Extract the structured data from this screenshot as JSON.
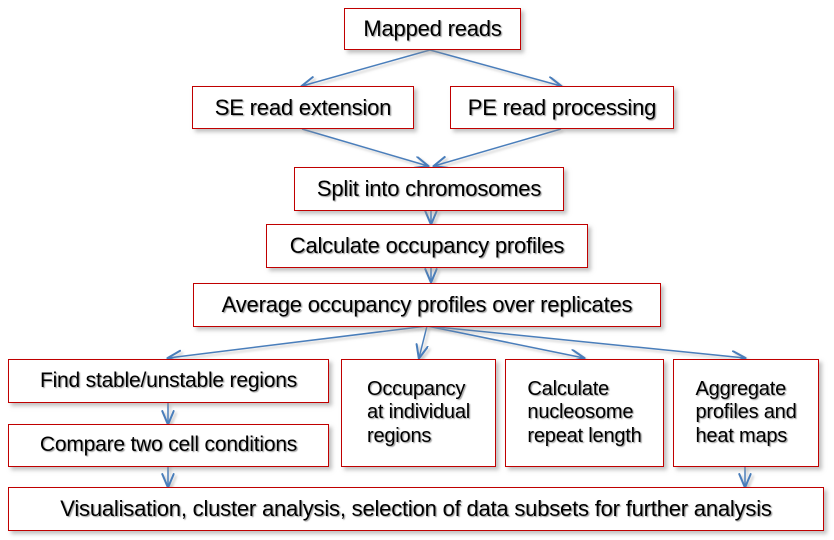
{
  "diagram": {
    "title": "Nucleosome occupancy analysis pipeline flowchart",
    "type": "flowchart",
    "colors": {
      "box_border": "#C00000",
      "box_fill": "#FFFFFF",
      "arrow": "#4A7EBB",
      "text": "#000000",
      "background": "#FFFFFF"
    },
    "nodes": {
      "mapped_reads": "Mapped reads",
      "se_read_extension": "SE read extension",
      "pe_read_processing": "PE read processing",
      "split_into_chromosomes": "Split into chromosomes",
      "calculate_occupancy_profiles": "Calculate occupancy profiles",
      "average_occupancy_profiles": "Average occupancy profiles over replicates",
      "find_stable_unstable_regions": "Find stable/unstable regions",
      "compare_two_cell_conditions": "Compare two cell conditions",
      "occupancy_at_individual_regions": "Occupancy\nat individual\nregions",
      "calculate_nucleosome_repeat_length": "Calculate\nnucleosome\nrepeat length",
      "aggregate_profiles_and_heat_maps": "Aggregate\nprofiles and\nheat maps",
      "visualisation_cluster_analysis": "Visualisation, cluster analysis, selection of data subsets for further analysis"
    },
    "edges": [
      {
        "from": "mapped_reads",
        "to": "se_read_extension"
      },
      {
        "from": "mapped_reads",
        "to": "pe_read_processing"
      },
      {
        "from": "se_read_extension",
        "to": "split_into_chromosomes"
      },
      {
        "from": "pe_read_processing",
        "to": "split_into_chromosomes"
      },
      {
        "from": "split_into_chromosomes",
        "to": "calculate_occupancy_profiles"
      },
      {
        "from": "calculate_occupancy_profiles",
        "to": "average_occupancy_profiles"
      },
      {
        "from": "average_occupancy_profiles",
        "to": "find_stable_unstable_regions"
      },
      {
        "from": "average_occupancy_profiles",
        "to": "occupancy_at_individual_regions"
      },
      {
        "from": "average_occupancy_profiles",
        "to": "calculate_nucleosome_repeat_length"
      },
      {
        "from": "average_occupancy_profiles",
        "to": "aggregate_profiles_and_heat_maps"
      },
      {
        "from": "find_stable_unstable_regions",
        "to": "compare_two_cell_conditions"
      },
      {
        "from": "compare_two_cell_conditions",
        "to": "visualisation_cluster_analysis"
      },
      {
        "from": "aggregate_profiles_and_heat_maps",
        "to": "visualisation_cluster_analysis"
      }
    ]
  }
}
